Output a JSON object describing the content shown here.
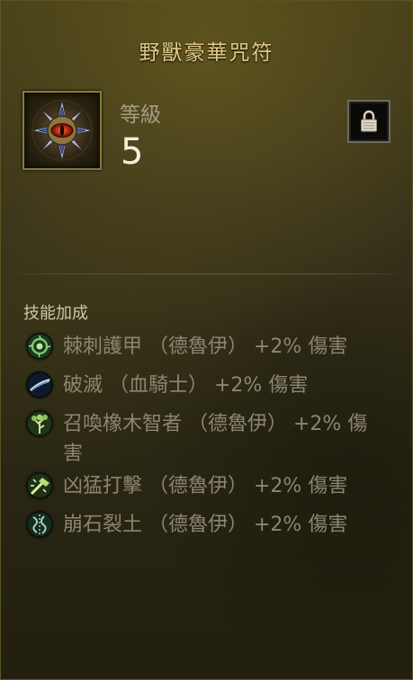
{
  "title": "野獸豪華咒符",
  "item": {
    "icon": "gem-eye-icon",
    "level_label": "等級",
    "level_value": "5",
    "lock_icon": "padlock-icon"
  },
  "skills_section": {
    "title": "技能加成",
    "items": [
      {
        "icon": "thorns-icon",
        "text": "棘刺護甲 （德魯伊） +2% 傷害",
        "color": "#3f7d3a"
      },
      {
        "icon": "blade-icon",
        "text": "破滅 （血騎士） +2% 傷害",
        "color": "#3f5f86"
      },
      {
        "icon": "oak-sage-icon",
        "text": "召喚橡木智者 （德魯伊） +2% 傷害",
        "color": "#4e7d2c"
      },
      {
        "icon": "maul-icon",
        "text": "凶猛打擊 （德魯伊） +2% 傷害",
        "color": "#5b8a2c"
      },
      {
        "icon": "earth-split-icon",
        "text": "崩石裂土 （德魯伊） +2% 傷害",
        "color": "#3c6f4d"
      }
    ]
  },
  "colors": {
    "title_gold": "#e3c98b",
    "skill_text": "#8c8571",
    "level_value": "#f5eedb"
  }
}
